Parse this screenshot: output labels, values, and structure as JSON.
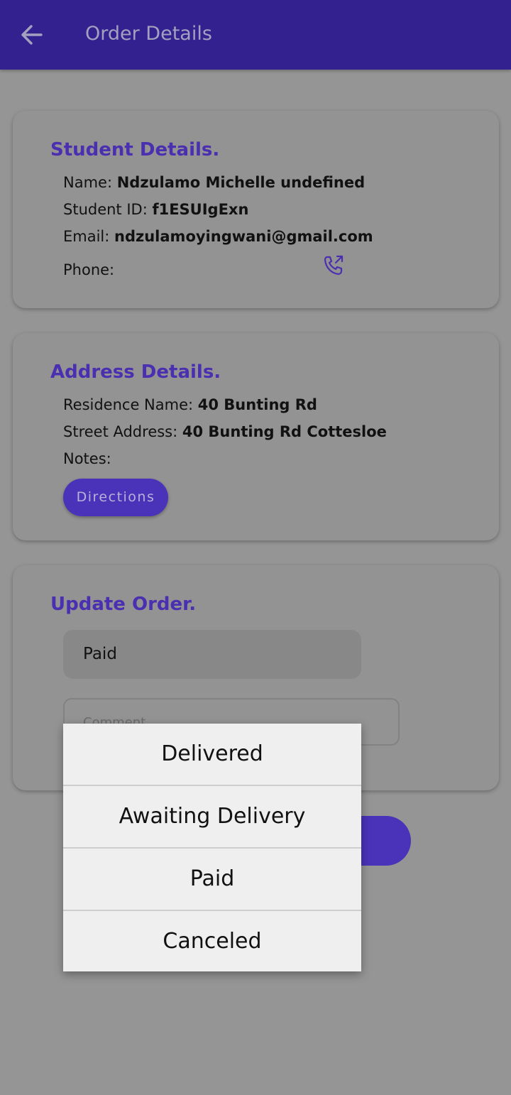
{
  "appbar": {
    "title": "Order Details",
    "back_icon": "arrow-left-icon",
    "color": "#33218f"
  },
  "student": {
    "title": "Student Details.",
    "name_label": "Name:",
    "name_value": "Ndzulamo Michelle undefined",
    "id_label": "Student ID:",
    "id_value": "f1ESUIgExn",
    "email_label": "Email:",
    "email_value": "ndzulamoyingwani@gmail.com",
    "phone_label": "Phone:",
    "phone_value": "",
    "call_icon": "phone-outgoing-icon"
  },
  "address": {
    "title": "Address Details.",
    "residence_label": "Residence Name:",
    "residence_value": "40 Bunting Rd",
    "street_label": "Street Address:",
    "street_value": "40 Bunting Rd Cottesloe",
    "notes_label": "Notes:",
    "notes_value": "",
    "directions_label": "Directions"
  },
  "update": {
    "title": "Update Order.",
    "status_value": "Paid",
    "comment_placeholder": "Comment"
  },
  "dropdown": {
    "options": [
      "Delivered",
      "Awaiting Delivery",
      "Paid",
      "Canceled"
    ]
  },
  "colors": {
    "accent": "#4a2fb0",
    "button": "#4a33b8"
  }
}
